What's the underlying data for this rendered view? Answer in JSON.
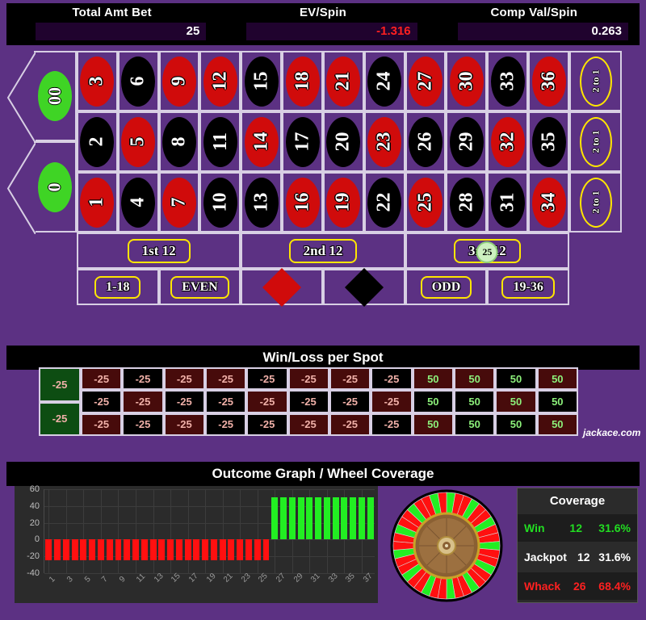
{
  "stats": [
    {
      "label": "Total Amt Bet",
      "value": "25",
      "negative": false
    },
    {
      "label": "EV/Spin",
      "value": "-1.316",
      "negative": true
    },
    {
      "label": "Comp Val/Spin",
      "value": "0.263",
      "negative": false
    }
  ],
  "table": {
    "zeros": [
      {
        "label": "00",
        "name": "double-zero"
      },
      {
        "label": "0",
        "name": "zero"
      }
    ],
    "numbers": [
      {
        "n": "3",
        "c": "red"
      },
      {
        "n": "6",
        "c": "black"
      },
      {
        "n": "9",
        "c": "red"
      },
      {
        "n": "12",
        "c": "red"
      },
      {
        "n": "15",
        "c": "black"
      },
      {
        "n": "18",
        "c": "red"
      },
      {
        "n": "21",
        "c": "red"
      },
      {
        "n": "24",
        "c": "black"
      },
      {
        "n": "27",
        "c": "red"
      },
      {
        "n": "30",
        "c": "red"
      },
      {
        "n": "33",
        "c": "black"
      },
      {
        "n": "36",
        "c": "red"
      },
      {
        "n": "2",
        "c": "black"
      },
      {
        "n": "5",
        "c": "red"
      },
      {
        "n": "8",
        "c": "black"
      },
      {
        "n": "11",
        "c": "black"
      },
      {
        "n": "14",
        "c": "red"
      },
      {
        "n": "17",
        "c": "black"
      },
      {
        "n": "20",
        "c": "black"
      },
      {
        "n": "23",
        "c": "red"
      },
      {
        "n": "26",
        "c": "black"
      },
      {
        "n": "29",
        "c": "black"
      },
      {
        "n": "32",
        "c": "red"
      },
      {
        "n": "35",
        "c": "black"
      },
      {
        "n": "1",
        "c": "red"
      },
      {
        "n": "4",
        "c": "black"
      },
      {
        "n": "7",
        "c": "red"
      },
      {
        "n": "10",
        "c": "black"
      },
      {
        "n": "13",
        "c": "black"
      },
      {
        "n": "16",
        "c": "red"
      },
      {
        "n": "19",
        "c": "red"
      },
      {
        "n": "22",
        "c": "black"
      },
      {
        "n": "25",
        "c": "red"
      },
      {
        "n": "28",
        "c": "black"
      },
      {
        "n": "31",
        "c": "black"
      },
      {
        "n": "34",
        "c": "red"
      }
    ],
    "column_bets": [
      "2 to 1",
      "2 to 1",
      "2 to 1"
    ],
    "dozens": [
      "1st 12",
      "2nd 12",
      "3rd 12"
    ],
    "outside": [
      {
        "label": "1-18",
        "type": "text"
      },
      {
        "label": "EVEN",
        "type": "text"
      },
      {
        "label": "",
        "type": "diamond-red"
      },
      {
        "label": "",
        "type": "diamond-black"
      },
      {
        "label": "ODD",
        "type": "text"
      },
      {
        "label": "19-36",
        "type": "text"
      }
    ],
    "chip": {
      "value": "25",
      "placed_on": "3rd 12"
    }
  },
  "winloss": {
    "title": "Win/Loss per Spot",
    "zeros": [
      "-25",
      "-25"
    ],
    "cells": [
      {
        "v": "-25",
        "c": "red"
      },
      {
        "v": "-25",
        "c": "black"
      },
      {
        "v": "-25",
        "c": "red"
      },
      {
        "v": "-25",
        "c": "red"
      },
      {
        "v": "-25",
        "c": "black"
      },
      {
        "v": "-25",
        "c": "red"
      },
      {
        "v": "-25",
        "c": "red"
      },
      {
        "v": "-25",
        "c": "black"
      },
      {
        "v": "50",
        "c": "red"
      },
      {
        "v": "50",
        "c": "red"
      },
      {
        "v": "50",
        "c": "black"
      },
      {
        "v": "50",
        "c": "red"
      },
      {
        "v": "-25",
        "c": "black"
      },
      {
        "v": "-25",
        "c": "red"
      },
      {
        "v": "-25",
        "c": "black"
      },
      {
        "v": "-25",
        "c": "black"
      },
      {
        "v": "-25",
        "c": "red"
      },
      {
        "v": "-25",
        "c": "black"
      },
      {
        "v": "-25",
        "c": "black"
      },
      {
        "v": "-25",
        "c": "red"
      },
      {
        "v": "50",
        "c": "black"
      },
      {
        "v": "50",
        "c": "black"
      },
      {
        "v": "50",
        "c": "red"
      },
      {
        "v": "50",
        "c": "black"
      },
      {
        "v": "-25",
        "c": "red"
      },
      {
        "v": "-25",
        "c": "black"
      },
      {
        "v": "-25",
        "c": "red"
      },
      {
        "v": "-25",
        "c": "black"
      },
      {
        "v": "-25",
        "c": "black"
      },
      {
        "v": "-25",
        "c": "red"
      },
      {
        "v": "-25",
        "c": "red"
      },
      {
        "v": "-25",
        "c": "black"
      },
      {
        "v": "50",
        "c": "red"
      },
      {
        "v": "50",
        "c": "black"
      },
      {
        "v": "50",
        "c": "black"
      },
      {
        "v": "50",
        "c": "red"
      }
    ],
    "watermark": "jackace.com"
  },
  "graph": {
    "title": "Outcome Graph / Wheel Coverage"
  },
  "coverage": {
    "title": "Coverage",
    "rows": [
      {
        "label": "Win",
        "count": "12",
        "pct": "31.6%"
      },
      {
        "label": "Jackpot",
        "count": "12",
        "pct": "31.6%"
      },
      {
        "label": "Whack",
        "count": "26",
        "pct": "68.4%"
      }
    ]
  },
  "chart_data": {
    "type": "bar",
    "title": "Outcome Graph / Wheel Coverage",
    "xlabel": "",
    "ylabel": "",
    "ylim": [
      -40,
      60
    ],
    "yticks": [
      60,
      40,
      20,
      0,
      -20,
      -40
    ],
    "grid": true,
    "legend": "none",
    "categories": [
      "1",
      "2",
      "3",
      "4",
      "5",
      "6",
      "7",
      "8",
      "9",
      "10",
      "11",
      "12",
      "13",
      "14",
      "15",
      "16",
      "17",
      "18",
      "19",
      "20",
      "21",
      "22",
      "23",
      "24",
      "25",
      "26",
      "27",
      "28",
      "29",
      "30",
      "31",
      "32",
      "33",
      "34",
      "35",
      "36",
      "37",
      "38"
    ],
    "xtick_labels": [
      "1",
      "3",
      "5",
      "7",
      "9",
      "11",
      "13",
      "15",
      "17",
      "19",
      "21",
      "23",
      "25",
      "27",
      "29",
      "31",
      "33",
      "35",
      "37"
    ],
    "values": [
      -25,
      -25,
      -25,
      -25,
      -25,
      -25,
      -25,
      -25,
      -25,
      -25,
      -25,
      -25,
      -25,
      -25,
      -25,
      -25,
      -25,
      -25,
      -25,
      -25,
      -25,
      -25,
      -25,
      -25,
      -25,
      -25,
      50,
      50,
      50,
      50,
      50,
      50,
      50,
      50,
      50,
      50,
      50,
      50
    ],
    "bar_colors": {
      "negative": "#ff1010",
      "positive": "#22ee22"
    }
  }
}
